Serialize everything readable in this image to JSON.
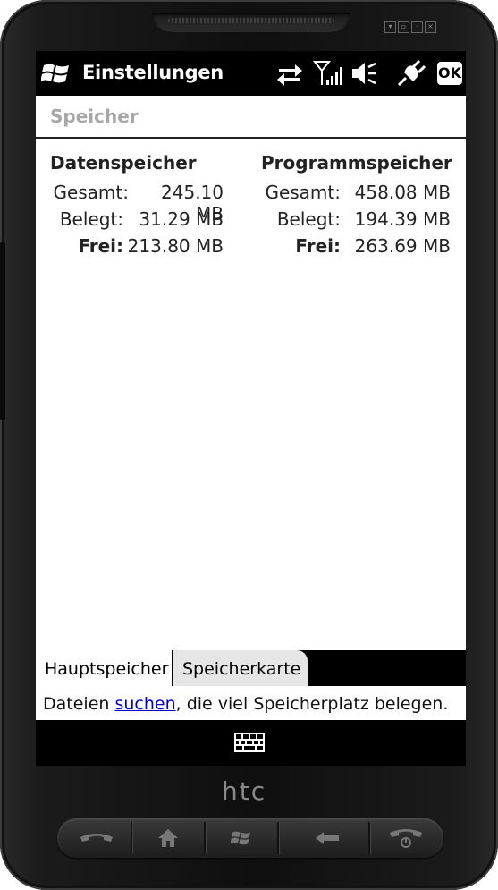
{
  "statusbar": {
    "title": "Einstellungen",
    "ok_label": "OK",
    "icons": [
      "windows-start-icon",
      "data-sync-icon",
      "signal-strength-icon",
      "speaker-mute-icon",
      "power-plug-icon"
    ]
  },
  "page": {
    "title": "Speicher"
  },
  "storage": {
    "data": {
      "title": "Datenspeicher",
      "rows": [
        {
          "label": "Gesamt:",
          "value": "245.10 MB"
        },
        {
          "label": "Belegt:",
          "value": "31.29 MB"
        },
        {
          "label": "Frei:",
          "value": "213.80 MB"
        }
      ]
    },
    "program": {
      "title": "Programmspeicher",
      "rows": [
        {
          "label": "Gesamt:",
          "value": "458.08 MB"
        },
        {
          "label": "Belegt:",
          "value": "194.39 MB"
        },
        {
          "label": "Frei:",
          "value": "263.69 MB"
        }
      ]
    }
  },
  "tabs": [
    {
      "label": "Hauptspeicher",
      "active": true
    },
    {
      "label": "Speicherkarte",
      "active": false
    }
  ],
  "hint": {
    "before": "Dateien ",
    "link": "suchen",
    "after": ", die viel Speicherplatz belegen."
  },
  "brand": "htc",
  "colors": {
    "link": "#0000cc",
    "title_gray": "#a7a7a7"
  }
}
